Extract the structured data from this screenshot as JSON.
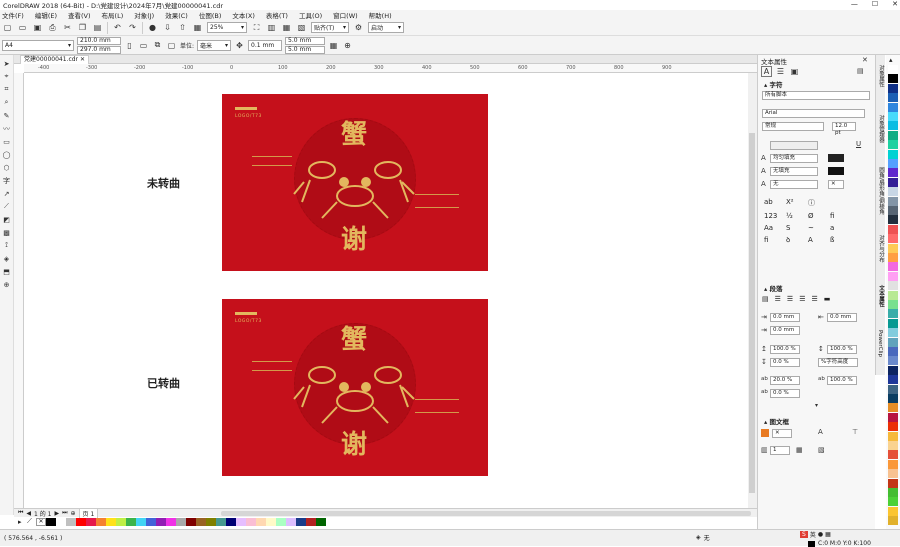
{
  "window": {
    "title": "CorelDRAW 2018 (64-Bit) - D:\\党建设计\\2024年7月\\党建00000041.cdr",
    "min": "—",
    "max": "☐",
    "close": "✕"
  },
  "menu": [
    "文件(F)",
    "编辑(E)",
    "查看(V)",
    "布局(L)",
    "对象(J)",
    "效果(C)",
    "位图(B)",
    "文本(X)",
    "表格(T)",
    "工具(O)",
    "窗口(W)",
    "帮助(H)"
  ],
  "toolbar": {
    "zoom": "25%",
    "snap": "贴齐(T)",
    "launch": "启动"
  },
  "propbar": {
    "page_size": "A4",
    "width": "210.0 mm",
    "height": "297.0 mm",
    "unit_label": "单位:",
    "unit": "毫米",
    "nudge": "0.1 mm",
    "dup_x": "5.0 mm",
    "dup_y": "5.0 mm"
  },
  "doc_tab": "党建00000041.cdr",
  "ruler": {
    "ticks": [
      "-400",
      "-300",
      "-200",
      "-100",
      "0",
      "100",
      "200",
      "300",
      "400",
      "500",
      "600",
      "700",
      "800",
      "900"
    ]
  },
  "canvas": {
    "label_top": "未转曲",
    "label_bottom": "已转曲",
    "art_char1": "蟹",
    "art_char2": "谢",
    "logo_text": "LOGO/T73"
  },
  "page_nav": {
    "position": "1 的 1",
    "page": "页 1"
  },
  "status": {
    "coords": "( 576.564 , -6.561 )",
    "fill_none": "无",
    "cmyk": "C:0 M:0 Y:0 K:100"
  },
  "panel": {
    "title": "文本属性",
    "char_section": "字符",
    "script": "所有脚本",
    "font": "Arial",
    "style": "常规",
    "size": "12.0 pt",
    "fill1": "均匀填充",
    "fill2": "无填充",
    "outline": "无",
    "para_section": "段落",
    "indent1": "0.0 mm",
    "indent2": "0.0 mm",
    "indent3": "0.0 mm",
    "spacing1": "100.0 %",
    "spacing2": "100.0 %",
    "spacing3": "0.0 %",
    "spacing_mode": "%字符高度",
    "char_space": "20.0 %",
    "word_space": "100.0 %",
    "lang_space": "0.0 %",
    "frame_section": "图文框",
    "columns": "1"
  },
  "vtabs": [
    "对象属性",
    "对象管理器",
    "圆角/扇形角/倒棱角",
    "对齐与分布",
    "文本属性",
    "PowerClip"
  ],
  "palette_colors": [
    "#000000",
    "#ffffff",
    "#c0c0c0",
    "#ff0000",
    "#e6194b",
    "#f58231",
    "#ffe119",
    "#bfef45",
    "#3cb44b",
    "#42d4f4",
    "#4363d8",
    "#911eb4",
    "#f032e6",
    "#a9a9a9",
    "#800000",
    "#9a6324",
    "#808000",
    "#469990",
    "#000075",
    "#e6beff",
    "#fabed4",
    "#ffd8b1",
    "#fffac8",
    "#aaffc3",
    "#dcbeff",
    "#1a3c8a",
    "#b22222",
    "#006400"
  ],
  "rpalette_colors": [
    "#ffffff",
    "#000000",
    "#0e2f86",
    "#1a5fb4",
    "#2e86de",
    "#48dbfb",
    "#0abde3",
    "#10ac84",
    "#1dd1a1",
    "#00d2d3",
    "#54a0ff",
    "#5f27cd",
    "#341f97",
    "#c8d6e5",
    "#8395a7",
    "#576574",
    "#222f3e",
    "#ee5253",
    "#ff6b6b",
    "#feca57",
    "#ff9f43",
    "#f368e0",
    "#ff9ff3",
    "#e1e1e1",
    "#b8e994",
    "#78e08f",
    "#38ada9",
    "#079992",
    "#82ccdd",
    "#60a3bc",
    "#4a69bd",
    "#6a89cc",
    "#0c2461",
    "#1e3799",
    "#3c6382",
    "#0a3d62",
    "#e58e26",
    "#b71540",
    "#eb2f06",
    "#f6b93b",
    "#fad390",
    "#e55039",
    "#fa983a",
    "#f8c291",
    "#c23616",
    "#44bd32",
    "#4cd137",
    "#fbc531",
    "#e1b12c"
  ]
}
